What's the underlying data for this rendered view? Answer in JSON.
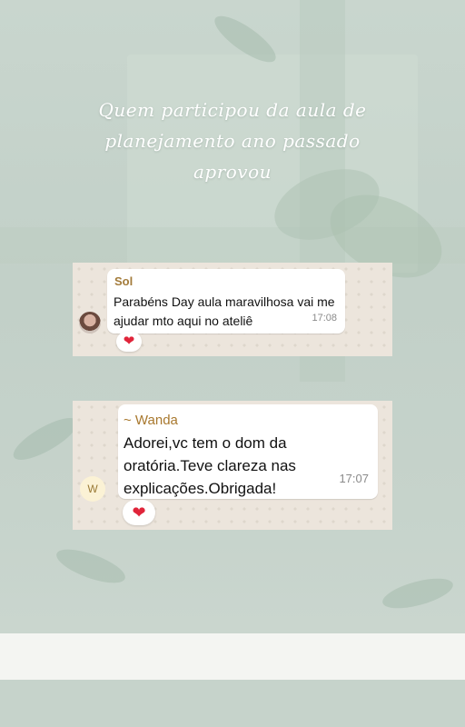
{
  "heading": {
    "line1": "Quem participou da aula de",
    "line2": "planejamento ano passado",
    "line3": "aprovou"
  },
  "messages": [
    {
      "sender": "Sol",
      "text": "Parabéns Day aula maravilhosa vai me ajudar mto aqui no ateliê",
      "time": "17:08",
      "reaction": "❤"
    },
    {
      "sender": "~ Wanda",
      "avatar_initial": "W",
      "text": "Adorei,vc tem o dom da oratória.Teve clareza nas explicações.Obrigada!",
      "time": "17:07",
      "reaction": "❤"
    }
  ],
  "colors": {
    "background": "#c4d2ca",
    "chat_background": "#ece5dc",
    "sender_name": "#a37b3a",
    "heart": "#e0243a"
  }
}
